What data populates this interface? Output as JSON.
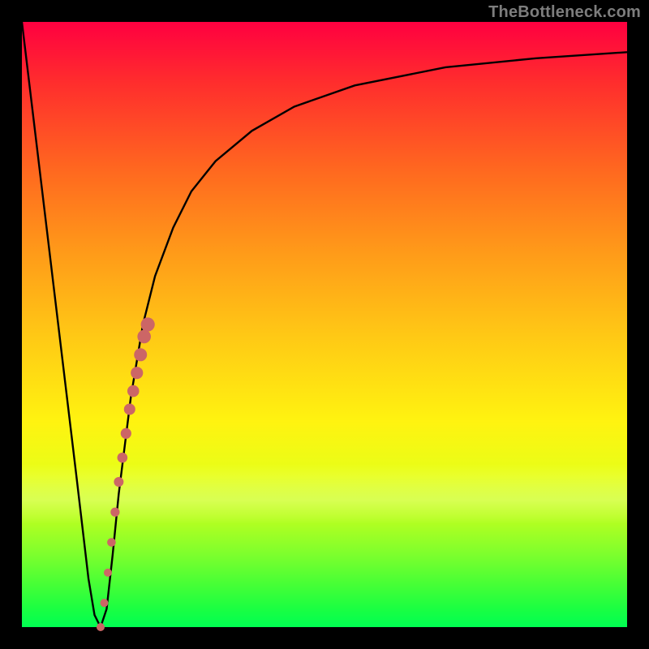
{
  "watermark": "TheBottleneck.com",
  "colors": {
    "frame": "#000000",
    "curve_stroke": "#000000",
    "series_fill": "#cc6666",
    "gradient_top": "#ff0040",
    "gradient_bottom": "#00ff52"
  },
  "chart_data": {
    "type": "line",
    "title": "",
    "xlabel": "",
    "ylabel": "",
    "xlim": [
      0,
      100
    ],
    "ylim": [
      0,
      100
    ],
    "curve": {
      "name": "bottleneck-curve",
      "x": [
        0,
        3,
        6,
        9,
        11,
        12,
        13,
        14,
        15,
        16,
        18,
        20,
        22,
        25,
        28,
        32,
        38,
        45,
        55,
        70,
        85,
        100
      ],
      "y": [
        100,
        75,
        50,
        25,
        8,
        2,
        0,
        3,
        12,
        22,
        38,
        50,
        58,
        66,
        72,
        77,
        82,
        86,
        89.5,
        92.5,
        94,
        95
      ]
    },
    "series": [
      {
        "name": "highlight-points",
        "type": "scatter",
        "color": "#cc6666",
        "x": [
          13.0,
          13.6,
          14.2,
          14.8,
          15.4,
          16.0,
          16.6,
          17.2,
          17.8,
          18.4,
          19.0,
          19.6,
          20.2,
          20.8
        ],
        "y": [
          0,
          4,
          9,
          14,
          19,
          24,
          28,
          32,
          36,
          39,
          42,
          45,
          48,
          50
        ],
        "r": [
          5,
          5,
          5,
          5.3,
          5.6,
          6,
          6.3,
          6.6,
          7,
          7.3,
          7.6,
          8,
          8.3,
          8.6
        ]
      }
    ]
  }
}
